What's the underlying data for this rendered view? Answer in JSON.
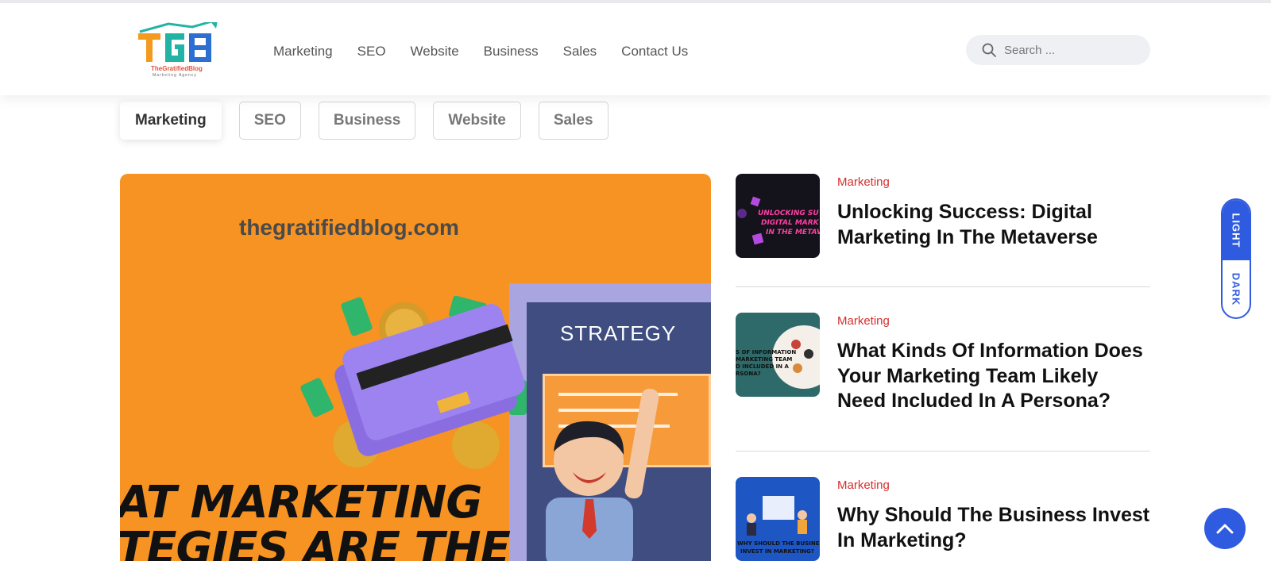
{
  "header": {
    "logo": {
      "name": "TheGratifiedBlog",
      "tagline": "Marketing Agency"
    },
    "nav": [
      "Marketing",
      "SEO",
      "Website",
      "Business",
      "Sales",
      "Contact Us"
    ],
    "search": {
      "placeholder": "Search ..."
    }
  },
  "category_tabs": {
    "items": [
      "Marketing",
      "SEO",
      "Business",
      "Website",
      "Sales"
    ],
    "active": "Marketing"
  },
  "hero": {
    "domain": "thegratifiedblog.com",
    "board_label": "STRATEGY",
    "headline_line1": "AT MARKETING",
    "headline_line2": "TEGIES ARE THE"
  },
  "posts": [
    {
      "category": "Marketing",
      "title": "Unlocking Success: Digital Marketing In The Metaverse",
      "thumb_color": "#14121a",
      "thumb_caption": "UNLOCKING SU DIGITAL MARK IN THE METAV"
    },
    {
      "category": "Marketing",
      "title": "What Kinds Of Information Does Your Marketing Team Likely Need Included In A Persona?",
      "thumb_color": "#2e6a6a",
      "thumb_caption": "S OF INFORMATION MARKETING TEAM D INCLUDED IN A RSONA?"
    },
    {
      "category": "Marketing",
      "title": "Why Should The Business Invest In Marketing?",
      "thumb_color": "#1e56c4",
      "thumb_caption": "WHY SHOULD THE BUSINESS INVEST IN MARKETING?"
    }
  ],
  "mode_toggle": {
    "light": "LIGHT",
    "dark": "DARK"
  },
  "colors": {
    "accent": "#2f5be0",
    "category_red": "#d3302f",
    "hero_orange": "#f69322"
  }
}
